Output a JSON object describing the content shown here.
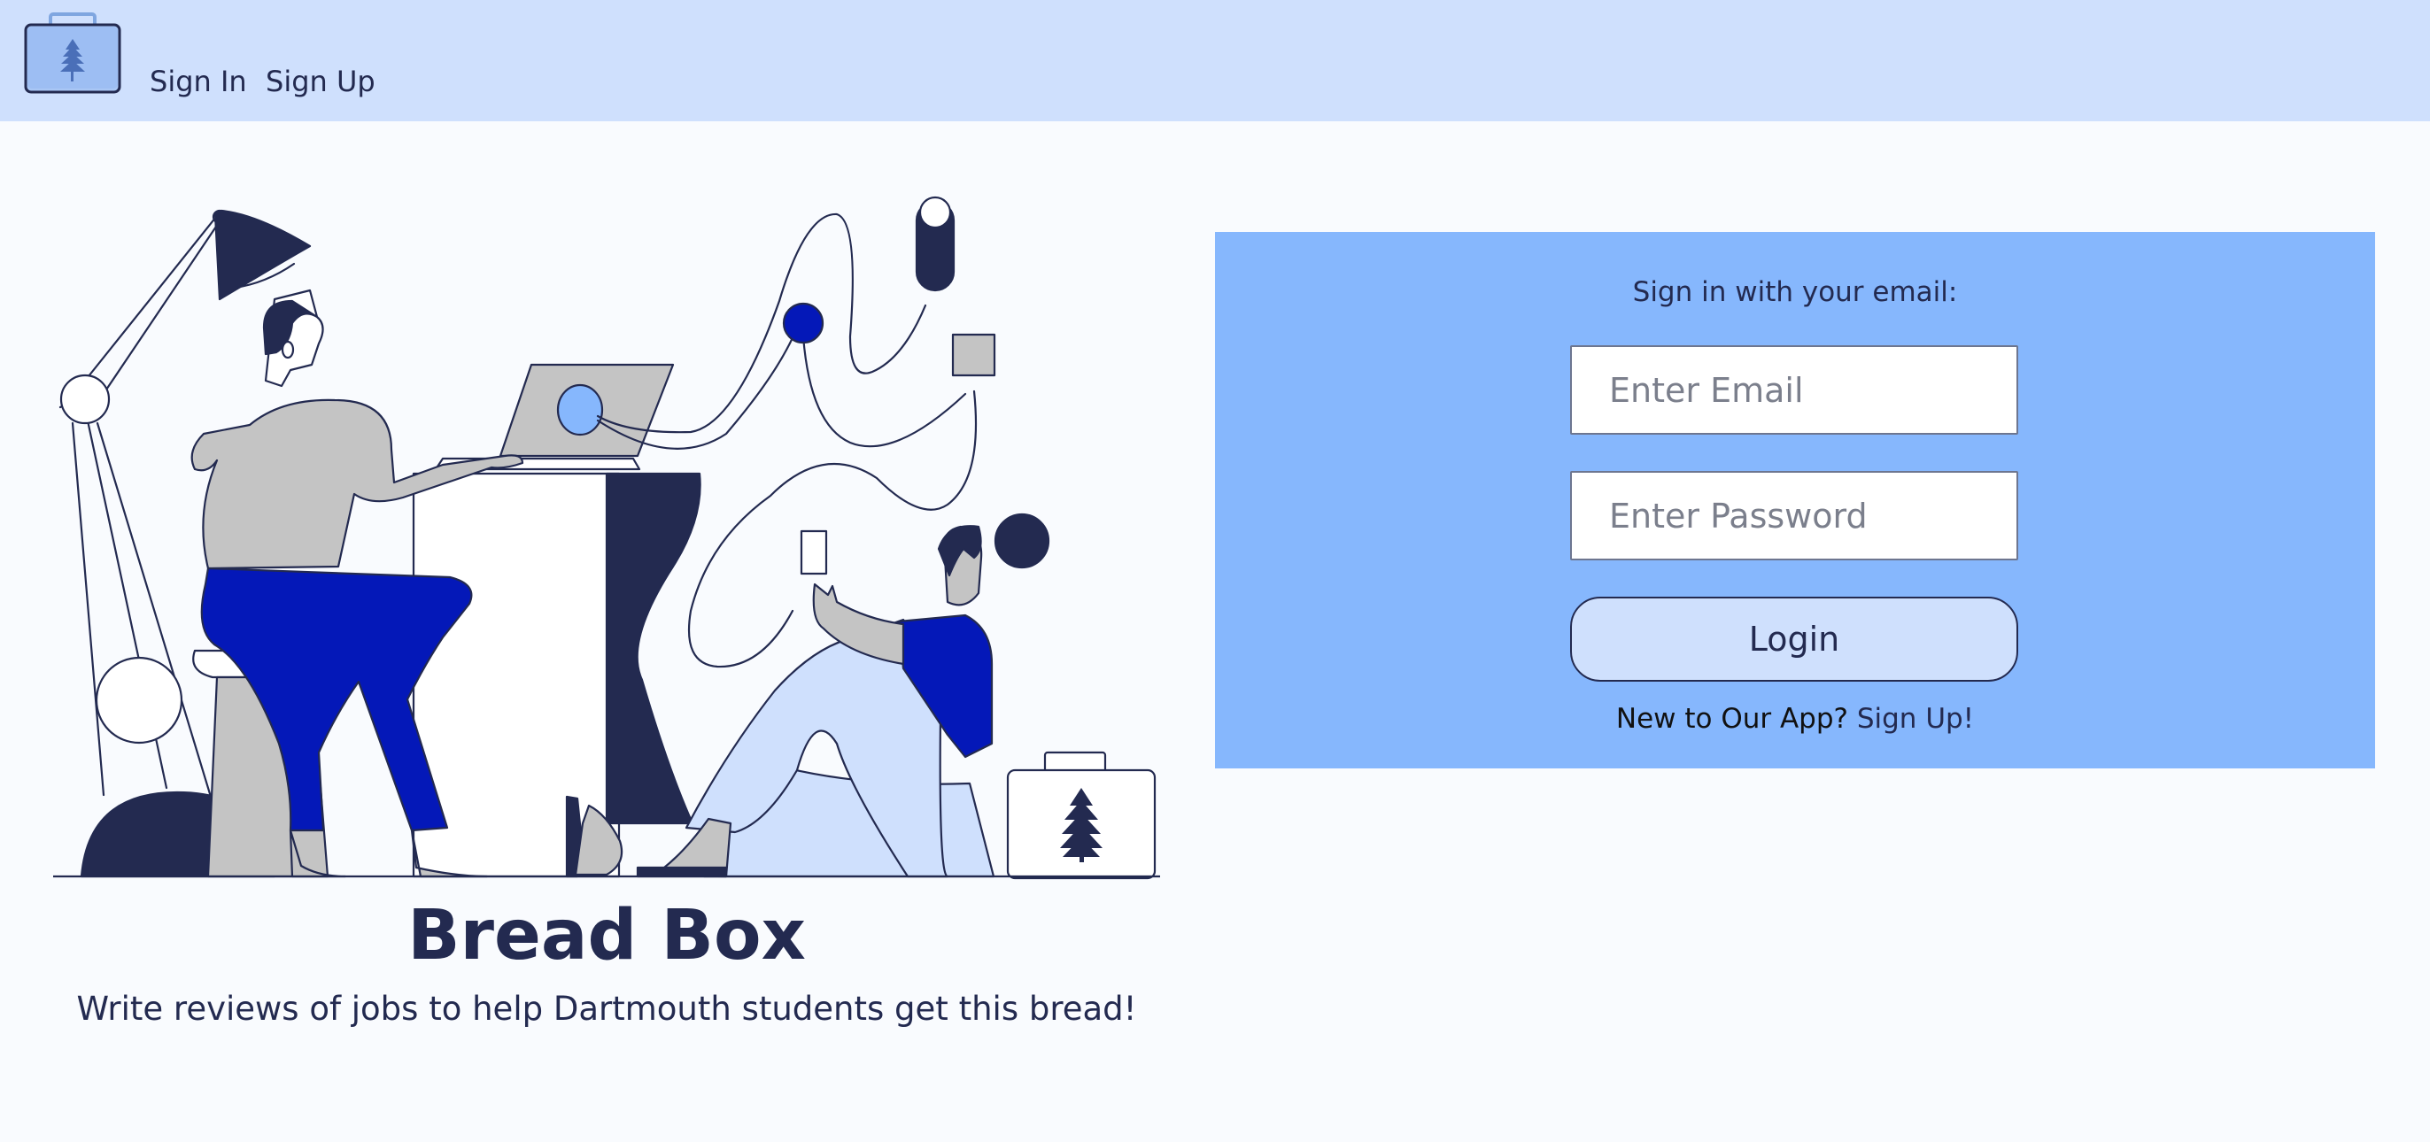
{
  "nav": {
    "logo_icon": "briefcase-pine-logo",
    "signin_label": "Sign In",
    "signup_label": "Sign Up"
  },
  "hero": {
    "illustration": "people-working-illustration",
    "title": "Bread Box",
    "subtitle": "Write reviews of jobs to help Dartmouth students get this bread!"
  },
  "login": {
    "prompt": "Sign in with your email:",
    "email_placeholder": "Enter Email",
    "password_placeholder": "Enter Password",
    "button_label": "Login",
    "signup_prefix": "New to Our App?",
    "signup_link": "Sign Up!"
  },
  "colors": {
    "nav_bg": "#cfe0fd",
    "panel_bg": "#86b7fd",
    "navy": "#232a50",
    "royal_blue": "#0418b8"
  }
}
